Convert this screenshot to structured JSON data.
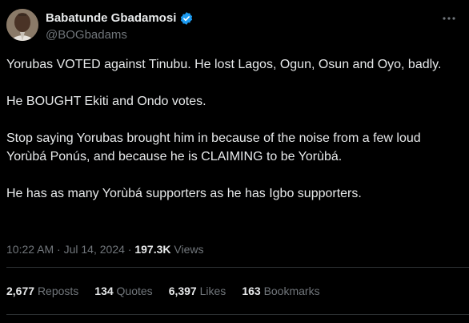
{
  "author": {
    "display_name": "Babatunde Gbadamosi",
    "handle": "@BOGbadams",
    "verified_icon": "verified-badge-icon",
    "verified_color": "#1d9bf0"
  },
  "tweet": {
    "paragraphs": [
      "Yorubas VOTED against Tinubu. He lost Lagos, Ogun, Osun and Oyo, badly.",
      "He BOUGHT Ekiti and Ondo votes.",
      "Stop saying Yorubas brought him in because of the noise from a few loud Yorùbá Ponús, and because he is CLAIMING to be Yorùbá.",
      "He has as many Yorùbá supporters as he has Igbo supporters."
    ],
    "time": "10:22 AM",
    "separator": "·",
    "date": "Jul 14, 2024",
    "views_count": "197.3K",
    "views_label": "Views"
  },
  "stats": {
    "reposts_count": "2,677",
    "reposts_label": "Reposts",
    "quotes_count": "134",
    "quotes_label": "Quotes",
    "likes_count": "6,397",
    "likes_label": "Likes",
    "bookmarks_count": "163",
    "bookmarks_label": "Bookmarks"
  },
  "colors": {
    "background": "#000000",
    "text_primary": "#e7e9ea",
    "text_secondary": "#71767b",
    "divider": "#2f3336"
  }
}
